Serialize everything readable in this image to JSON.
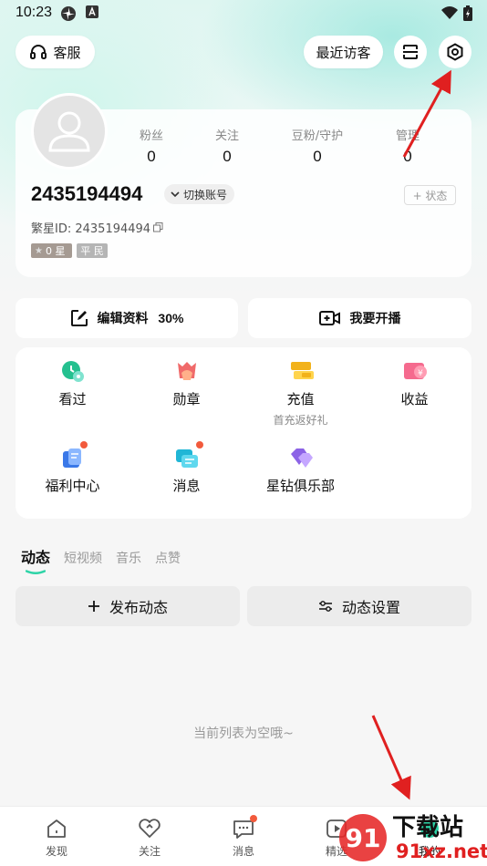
{
  "status_bar": {
    "time": "10:23"
  },
  "header": {
    "service_label": "客服",
    "recent_visitors_label": "最近访客"
  },
  "profile": {
    "stats": [
      {
        "label": "粉丝",
        "value": "0"
      },
      {
        "label": "关注",
        "value": "0"
      },
      {
        "label": "豆粉/守护",
        "value": "0"
      },
      {
        "label": "管理",
        "value": "0"
      }
    ],
    "user_id": "2435194494",
    "switch_account_label": "切换账号",
    "status_label": "+ 状态",
    "fanxing_id": "繁星ID: 2435194494",
    "star_level": "0 星",
    "rank_badge": "平 民"
  },
  "actions": {
    "edit_profile_label": "编辑资料",
    "edit_profile_percent": "30%",
    "start_live_label": "我要开播"
  },
  "grid_items": [
    {
      "label": "看过",
      "sub": ""
    },
    {
      "label": "勋章",
      "sub": ""
    },
    {
      "label": "充值",
      "sub": "首充返好礼"
    },
    {
      "label": "收益",
      "sub": ""
    },
    {
      "label": "福利中心",
      "sub": ""
    },
    {
      "label": "消息",
      "sub": ""
    },
    {
      "label": "星钻俱乐部",
      "sub": ""
    }
  ],
  "tabs": [
    "动态",
    "短视频",
    "音乐",
    "点赞"
  ],
  "post_buttons": {
    "publish_label": "发布动态",
    "settings_label": "动态设置"
  },
  "empty_message": "当前列表为空哦~",
  "bottom_nav": [
    {
      "label": "发现"
    },
    {
      "label": "关注"
    },
    {
      "label": "消息"
    },
    {
      "label": "精选"
    },
    {
      "label": "我的"
    }
  ],
  "watermark": {
    "text_top": "下载站",
    "text_bottom": "91xz.net",
    "logo_number": "91"
  },
  "colors": {
    "accent": "#2dd4a7",
    "arrow": "#e02020",
    "red_dot": "#f25a3c"
  }
}
